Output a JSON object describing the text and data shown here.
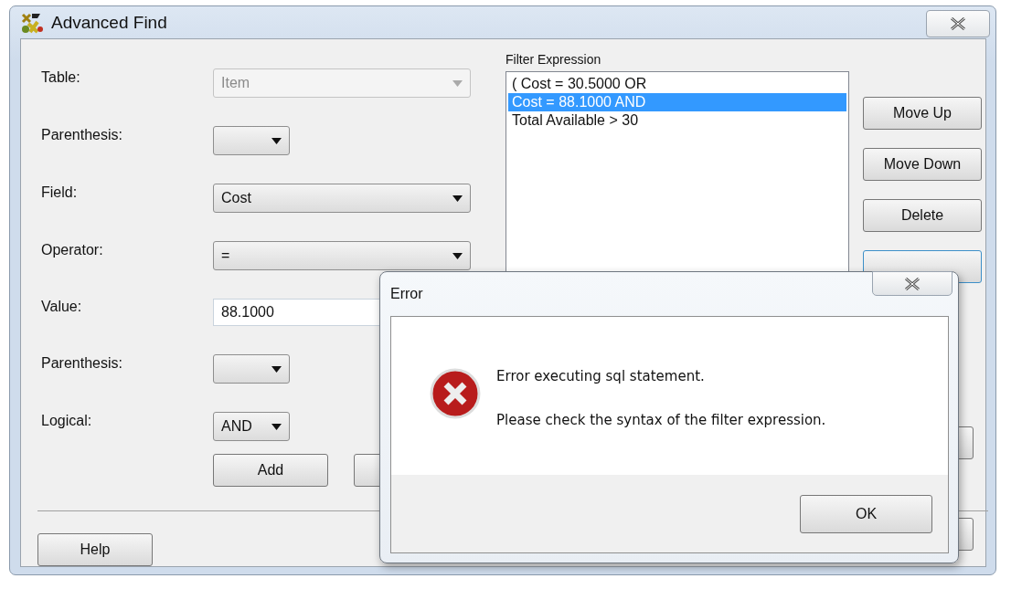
{
  "window": {
    "title": "Advanced Find"
  },
  "form": [
    {
      "label": "Table:",
      "kind": "combo",
      "value": "Item",
      "disabled": true
    },
    {
      "label": "Parenthesis:",
      "kind": "picker",
      "disabled": false
    },
    {
      "label": "Field:",
      "kind": "combo",
      "value": "Cost",
      "disabled": false
    },
    {
      "label": "Operator:",
      "kind": "combo",
      "value": "=",
      "disabled": false
    },
    {
      "label": "Value:",
      "kind": "input",
      "value": "88.1000",
      "disabled": false
    },
    {
      "label": "Parenthesis:",
      "kind": "picker",
      "disabled": false
    },
    {
      "label": "Logical:",
      "kind": "picker",
      "value": "AND",
      "disabled": false
    }
  ],
  "add_button": "Add",
  "help_button": "Help",
  "filter": {
    "label": "Filter Expression",
    "items": [
      {
        "text": "( Cost = 30.5000 OR",
        "selected": false
      },
      {
        "text": "Cost = 88.1000 AND",
        "selected": true
      },
      {
        "text": "Total Available > 30",
        "selected": false
      }
    ]
  },
  "side_buttons": [
    "Move Up",
    "Move Down",
    "Delete"
  ],
  "error_dialog": {
    "title": "Error",
    "messages": [
      "Error executing sql statement.",
      "Please check the syntax of the filter expression."
    ],
    "ok": "OK"
  }
}
